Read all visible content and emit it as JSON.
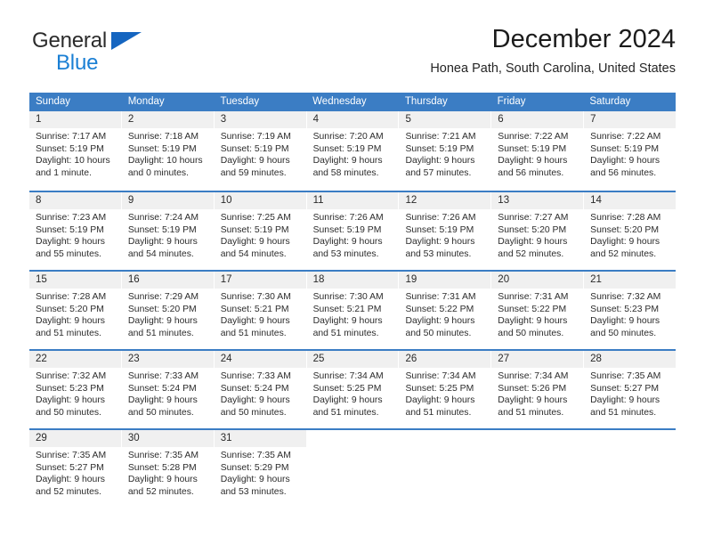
{
  "brand": {
    "name_part1": "General",
    "name_part2": "Blue",
    "triangle_color": "#1565c0",
    "blue_color": "#1a7fd4"
  },
  "header": {
    "title": "December 2024",
    "subtitle": "Honea Path, South Carolina, United States"
  },
  "theme": {
    "header_blue": "#3b7dc4",
    "day_number_bg": "#f0f0f0"
  },
  "calendar": {
    "weekdays": [
      "Sunday",
      "Monday",
      "Tuesday",
      "Wednesday",
      "Thursday",
      "Friday",
      "Saturday"
    ],
    "weeks": [
      [
        {
          "day": "1",
          "sunrise": "Sunrise: 7:17 AM",
          "sunset": "Sunset: 5:19 PM",
          "daylight_line1": "Daylight: 10 hours",
          "daylight_line2": "and 1 minute."
        },
        {
          "day": "2",
          "sunrise": "Sunrise: 7:18 AM",
          "sunset": "Sunset: 5:19 PM",
          "daylight_line1": "Daylight: 10 hours",
          "daylight_line2": "and 0 minutes."
        },
        {
          "day": "3",
          "sunrise": "Sunrise: 7:19 AM",
          "sunset": "Sunset: 5:19 PM",
          "daylight_line1": "Daylight: 9 hours",
          "daylight_line2": "and 59 minutes."
        },
        {
          "day": "4",
          "sunrise": "Sunrise: 7:20 AM",
          "sunset": "Sunset: 5:19 PM",
          "daylight_line1": "Daylight: 9 hours",
          "daylight_line2": "and 58 minutes."
        },
        {
          "day": "5",
          "sunrise": "Sunrise: 7:21 AM",
          "sunset": "Sunset: 5:19 PM",
          "daylight_line1": "Daylight: 9 hours",
          "daylight_line2": "and 57 minutes."
        },
        {
          "day": "6",
          "sunrise": "Sunrise: 7:22 AM",
          "sunset": "Sunset: 5:19 PM",
          "daylight_line1": "Daylight: 9 hours",
          "daylight_line2": "and 56 minutes."
        },
        {
          "day": "7",
          "sunrise": "Sunrise: 7:22 AM",
          "sunset": "Sunset: 5:19 PM",
          "daylight_line1": "Daylight: 9 hours",
          "daylight_line2": "and 56 minutes."
        }
      ],
      [
        {
          "day": "8",
          "sunrise": "Sunrise: 7:23 AM",
          "sunset": "Sunset: 5:19 PM",
          "daylight_line1": "Daylight: 9 hours",
          "daylight_line2": "and 55 minutes."
        },
        {
          "day": "9",
          "sunrise": "Sunrise: 7:24 AM",
          "sunset": "Sunset: 5:19 PM",
          "daylight_line1": "Daylight: 9 hours",
          "daylight_line2": "and 54 minutes."
        },
        {
          "day": "10",
          "sunrise": "Sunrise: 7:25 AM",
          "sunset": "Sunset: 5:19 PM",
          "daylight_line1": "Daylight: 9 hours",
          "daylight_line2": "and 54 minutes."
        },
        {
          "day": "11",
          "sunrise": "Sunrise: 7:26 AM",
          "sunset": "Sunset: 5:19 PM",
          "daylight_line1": "Daylight: 9 hours",
          "daylight_line2": "and 53 minutes."
        },
        {
          "day": "12",
          "sunrise": "Sunrise: 7:26 AM",
          "sunset": "Sunset: 5:19 PM",
          "daylight_line1": "Daylight: 9 hours",
          "daylight_line2": "and 53 minutes."
        },
        {
          "day": "13",
          "sunrise": "Sunrise: 7:27 AM",
          "sunset": "Sunset: 5:20 PM",
          "daylight_line1": "Daylight: 9 hours",
          "daylight_line2": "and 52 minutes."
        },
        {
          "day": "14",
          "sunrise": "Sunrise: 7:28 AM",
          "sunset": "Sunset: 5:20 PM",
          "daylight_line1": "Daylight: 9 hours",
          "daylight_line2": "and 52 minutes."
        }
      ],
      [
        {
          "day": "15",
          "sunrise": "Sunrise: 7:28 AM",
          "sunset": "Sunset: 5:20 PM",
          "daylight_line1": "Daylight: 9 hours",
          "daylight_line2": "and 51 minutes."
        },
        {
          "day": "16",
          "sunrise": "Sunrise: 7:29 AM",
          "sunset": "Sunset: 5:20 PM",
          "daylight_line1": "Daylight: 9 hours",
          "daylight_line2": "and 51 minutes."
        },
        {
          "day": "17",
          "sunrise": "Sunrise: 7:30 AM",
          "sunset": "Sunset: 5:21 PM",
          "daylight_line1": "Daylight: 9 hours",
          "daylight_line2": "and 51 minutes."
        },
        {
          "day": "18",
          "sunrise": "Sunrise: 7:30 AM",
          "sunset": "Sunset: 5:21 PM",
          "daylight_line1": "Daylight: 9 hours",
          "daylight_line2": "and 51 minutes."
        },
        {
          "day": "19",
          "sunrise": "Sunrise: 7:31 AM",
          "sunset": "Sunset: 5:22 PM",
          "daylight_line1": "Daylight: 9 hours",
          "daylight_line2": "and 50 minutes."
        },
        {
          "day": "20",
          "sunrise": "Sunrise: 7:31 AM",
          "sunset": "Sunset: 5:22 PM",
          "daylight_line1": "Daylight: 9 hours",
          "daylight_line2": "and 50 minutes."
        },
        {
          "day": "21",
          "sunrise": "Sunrise: 7:32 AM",
          "sunset": "Sunset: 5:23 PM",
          "daylight_line1": "Daylight: 9 hours",
          "daylight_line2": "and 50 minutes."
        }
      ],
      [
        {
          "day": "22",
          "sunrise": "Sunrise: 7:32 AM",
          "sunset": "Sunset: 5:23 PM",
          "daylight_line1": "Daylight: 9 hours",
          "daylight_line2": "and 50 minutes."
        },
        {
          "day": "23",
          "sunrise": "Sunrise: 7:33 AM",
          "sunset": "Sunset: 5:24 PM",
          "daylight_line1": "Daylight: 9 hours",
          "daylight_line2": "and 50 minutes."
        },
        {
          "day": "24",
          "sunrise": "Sunrise: 7:33 AM",
          "sunset": "Sunset: 5:24 PM",
          "daylight_line1": "Daylight: 9 hours",
          "daylight_line2": "and 50 minutes."
        },
        {
          "day": "25",
          "sunrise": "Sunrise: 7:34 AM",
          "sunset": "Sunset: 5:25 PM",
          "daylight_line1": "Daylight: 9 hours",
          "daylight_line2": "and 51 minutes."
        },
        {
          "day": "26",
          "sunrise": "Sunrise: 7:34 AM",
          "sunset": "Sunset: 5:25 PM",
          "daylight_line1": "Daylight: 9 hours",
          "daylight_line2": "and 51 minutes."
        },
        {
          "day": "27",
          "sunrise": "Sunrise: 7:34 AM",
          "sunset": "Sunset: 5:26 PM",
          "daylight_line1": "Daylight: 9 hours",
          "daylight_line2": "and 51 minutes."
        },
        {
          "day": "28",
          "sunrise": "Sunrise: 7:35 AM",
          "sunset": "Sunset: 5:27 PM",
          "daylight_line1": "Daylight: 9 hours",
          "daylight_line2": "and 51 minutes."
        }
      ],
      [
        {
          "day": "29",
          "sunrise": "Sunrise: 7:35 AM",
          "sunset": "Sunset: 5:27 PM",
          "daylight_line1": "Daylight: 9 hours",
          "daylight_line2": "and 52 minutes."
        },
        {
          "day": "30",
          "sunrise": "Sunrise: 7:35 AM",
          "sunset": "Sunset: 5:28 PM",
          "daylight_line1": "Daylight: 9 hours",
          "daylight_line2": "and 52 minutes."
        },
        {
          "day": "31",
          "sunrise": "Sunrise: 7:35 AM",
          "sunset": "Sunset: 5:29 PM",
          "daylight_line1": "Daylight: 9 hours",
          "daylight_line2": "and 53 minutes."
        },
        {
          "day": "",
          "sunrise": "",
          "sunset": "",
          "daylight_line1": "",
          "daylight_line2": ""
        },
        {
          "day": "",
          "sunrise": "",
          "sunset": "",
          "daylight_line1": "",
          "daylight_line2": ""
        },
        {
          "day": "",
          "sunrise": "",
          "sunset": "",
          "daylight_line1": "",
          "daylight_line2": ""
        },
        {
          "day": "",
          "sunrise": "",
          "sunset": "",
          "daylight_line1": "",
          "daylight_line2": ""
        }
      ]
    ]
  }
}
